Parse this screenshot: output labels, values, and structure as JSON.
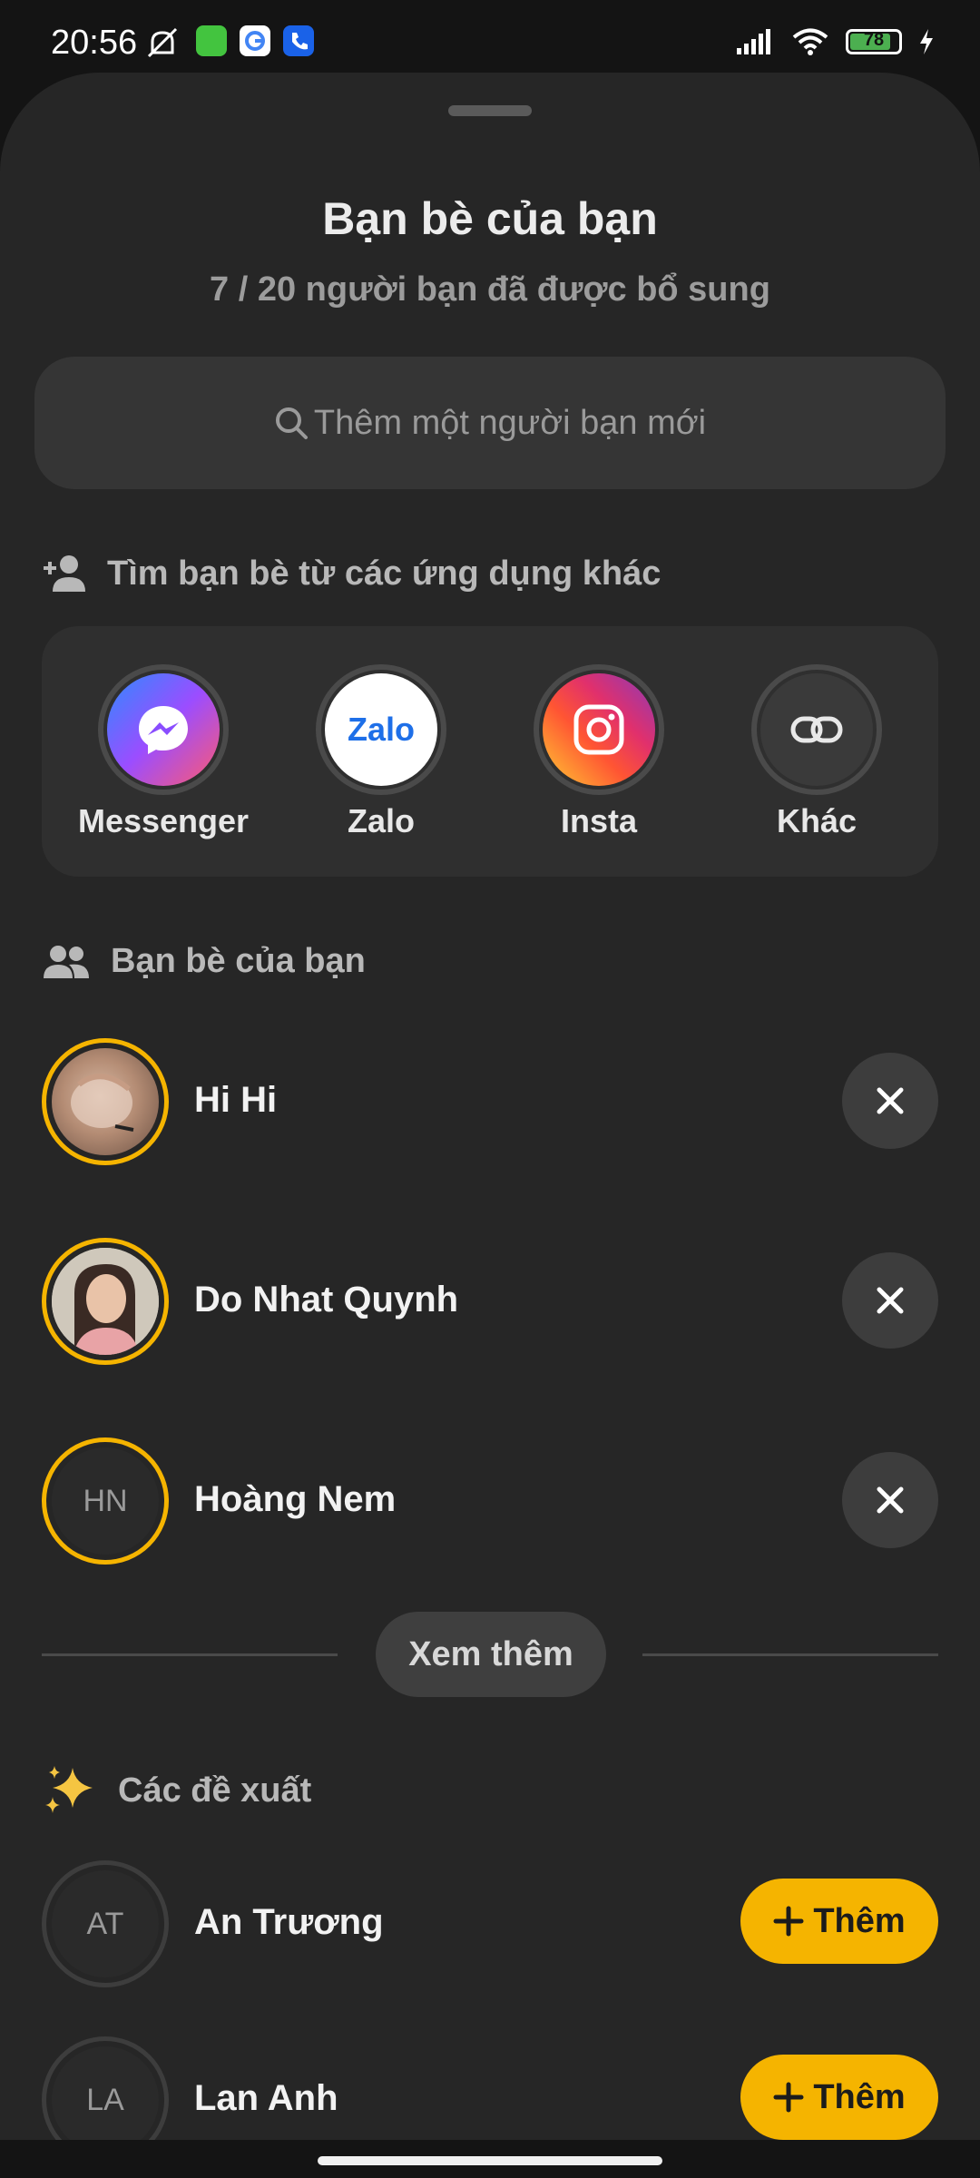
{
  "status_bar": {
    "time": "20:56",
    "battery": 78,
    "battery_label": "78",
    "icons": [
      "mute-icon",
      "app-icon",
      "google-icon",
      "phone-app-icon",
      "signal-icon",
      "wifi-icon",
      "battery-icon",
      "charging-icon"
    ]
  },
  "header": {
    "title": "Bạn bè của bạn",
    "subtitle": "7 / 20 người bạn đã được bổ sung"
  },
  "search": {
    "placeholder": "Thêm một người bạn mới"
  },
  "find_section": {
    "label": "Tìm bạn bè từ các ứng dụng khác",
    "apps": [
      {
        "name": "Messenger",
        "icon": "messenger-icon"
      },
      {
        "name": "Zalo",
        "icon": "zalo-icon",
        "logo_text": "Zalo"
      },
      {
        "name": "Insta",
        "icon": "instagram-icon"
      },
      {
        "name": "Khác",
        "icon": "link-icon"
      }
    ]
  },
  "friends_section": {
    "label": "Bạn bè của bạn",
    "friends": [
      {
        "name": "Hi Hi",
        "avatar": "photo"
      },
      {
        "name": "Do Nhat Quynh",
        "avatar": "photo"
      },
      {
        "name": "Hoàng Nem",
        "initials": "HN"
      }
    ],
    "more_label": "Xem thêm"
  },
  "suggestions_section": {
    "label": "Các đề xuất",
    "icon": "sparkles-icon",
    "items": [
      {
        "name": "An Trương",
        "initials": "AT",
        "action": "Thêm"
      },
      {
        "name": "Lan Anh",
        "initials": "LA",
        "action": "Thêm"
      }
    ]
  },
  "colors": {
    "accent": "#f5b400",
    "sheet": "#262626",
    "background": "#141414"
  }
}
